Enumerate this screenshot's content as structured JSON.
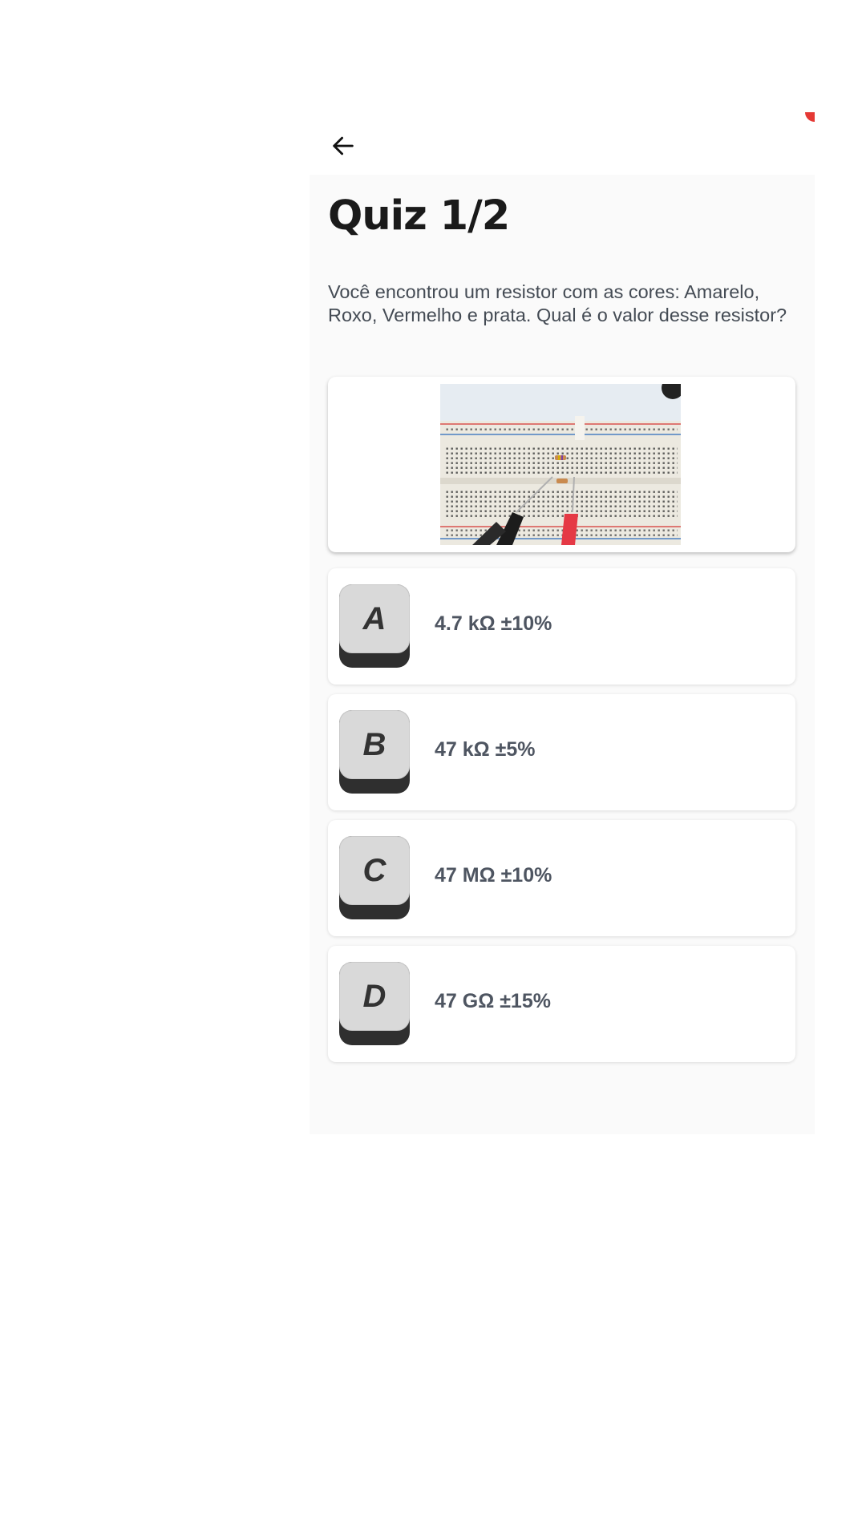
{
  "header": {
    "back_icon": "arrow-left-icon"
  },
  "quiz": {
    "title": "Quiz 1/2",
    "question": "Você encontrou um resistor com as cores: Amarelo, Roxo, Vermelho e prata. Qual é o valor desse resistor?"
  },
  "options": [
    {
      "key": "A",
      "label": "4.7 kΩ ±10%"
    },
    {
      "key": "B",
      "label": "47 kΩ ±5%"
    },
    {
      "key": "C",
      "label": "47 MΩ ±10%"
    },
    {
      "key": "D",
      "label": "47 GΩ ±15%"
    }
  ],
  "colors": {
    "background": "#fafafa",
    "card": "#ffffff",
    "key_face": "#d9d9d9",
    "key_shadow": "#2f2f2f",
    "text_primary": "#1a1a1a",
    "text_secondary": "#4e5561"
  }
}
